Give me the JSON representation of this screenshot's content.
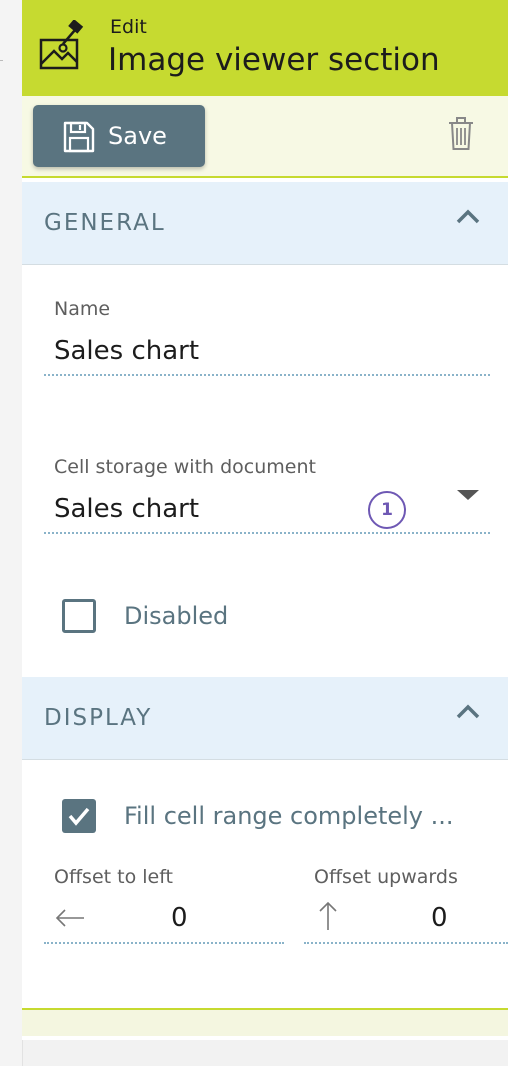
{
  "header": {
    "subtitle": "Edit",
    "title": "Image viewer section"
  },
  "toolbar": {
    "save_label": "Save"
  },
  "general": {
    "title": "GENERAL",
    "name_label": "Name",
    "name_value": "Sales chart",
    "cell_label": "Cell storage with document",
    "cell_value": "Sales chart",
    "badge": "1",
    "disabled_label": "Disabled",
    "disabled_checked": false
  },
  "display": {
    "title": "DISPLAY",
    "fill_label": "Fill cell range completely ...",
    "fill_checked": true,
    "offset_left_label": "Offset to left",
    "offset_left_value": "0",
    "offset_up_label": "Offset upwards",
    "offset_up_value": "0"
  },
  "colors": {
    "header_accent": "#c6da30",
    "primary": "#5a7480",
    "section_bg": "#e6f1fa",
    "badge": "#6e58b4"
  },
  "icons": [
    "image-pin-icon",
    "floppy-disk-icon",
    "trash-icon",
    "chevron-up-icon",
    "caret-down-icon",
    "checkmark-icon",
    "arrow-left-icon",
    "arrow-up-icon"
  ]
}
